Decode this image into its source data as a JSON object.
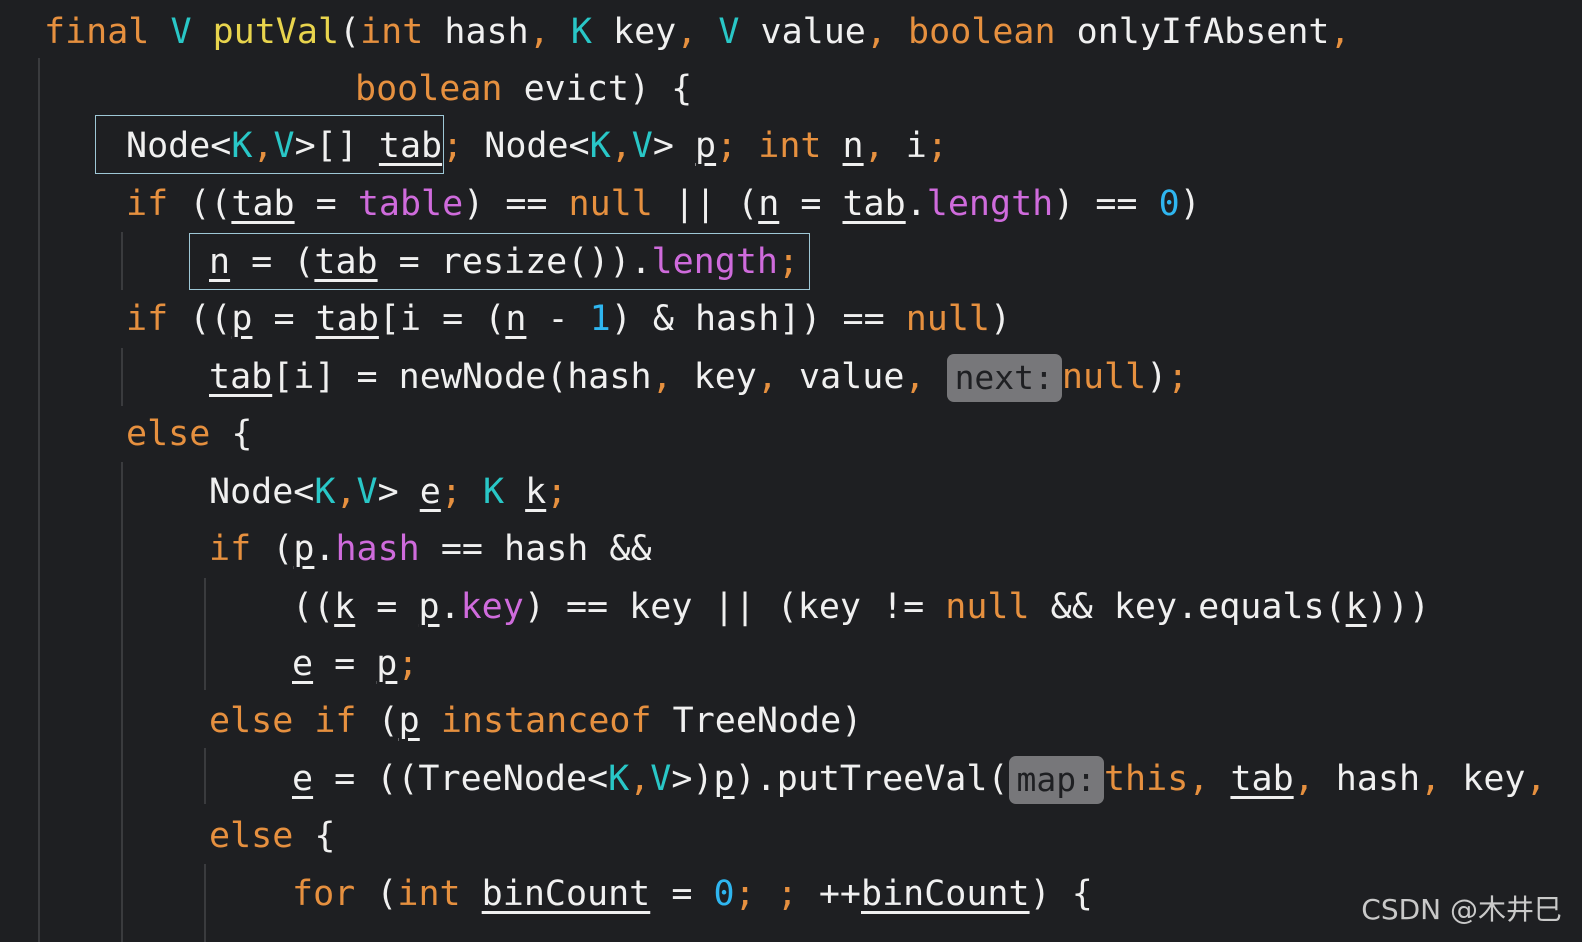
{
  "code": {
    "l1": {
      "final": "final",
      "V": "V",
      "putVal": "putVal",
      "paren": "(",
      "int": "int",
      "hash": " hash",
      "comma1": ",",
      "K": "K",
      "key": " key",
      "comma2": ",",
      "V2": "V",
      "value": " value",
      "comma3": ",",
      "boolean": "boolean",
      "onlyIfAbsent": " onlyIfAbsent",
      "comma4": ","
    },
    "l2": {
      "boolean": "boolean",
      "rest": " evict) {"
    },
    "l3": {
      "node1": "Node<",
      "K": "K",
      "comma": ",",
      "V": "V",
      "node1end": ">[] ",
      "tab": "tab",
      "semi1": ";",
      "node2": " Node<",
      "K2": "K",
      "comma2": ",",
      "V2": "V",
      "node2end": "> ",
      "p": "p",
      "semi2": ";",
      "int": "int",
      "n": "n",
      "comma3": ",",
      "i": " i",
      "semi3": ";"
    },
    "l4": {
      "if": "if",
      "open": " ((",
      "tab": "tab",
      "eq": " = ",
      "table": "table",
      "close": ") == ",
      "null": "null",
      "or": " || (",
      "n": "n",
      "eq2": " = ",
      "tab2": "tab",
      "dot": ".",
      "length": "length",
      "close2": ") == ",
      "zero": "0",
      "end": ")"
    },
    "l5": {
      "n": "n",
      "eq": " = (",
      "tab": "tab",
      "rest": " = resize()).",
      "length": "length",
      "semi": ";"
    },
    "l6": {
      "if": "if",
      "open": " ((",
      "p": "p",
      "eq": " = ",
      "tab": "tab",
      "mid": "[i = (",
      "n": "n",
      "minus": " - ",
      "one": "1",
      "rest": ") & hash]) == ",
      "null": "null",
      "end": ")"
    },
    "l7": {
      "tab": "tab",
      "mid": "[i] = newNode(hash",
      "c1": ",",
      "key": " key",
      "c2": ",",
      "value": " value",
      "c3": ",",
      "hint": "next:",
      "null": "null",
      "end": ")",
      "semi": ";"
    },
    "l8": {
      "else": "else",
      "rest": " {"
    },
    "l9": {
      "node": "Node<",
      "K": "K",
      "comma": ",",
      "V": "V",
      "end": "> ",
      "e": "e",
      "semi": ";",
      "K2": "K",
      "k": "k",
      "semi2": ";"
    },
    "l10": {
      "if": "if",
      "open": " (",
      "p": "p",
      "dot": ".",
      "hash": "hash",
      "rest": " == hash &&"
    },
    "l11": {
      "open": "((",
      "k": "k",
      "eq": " = ",
      "p": "p",
      "dot": ".",
      "key": "key",
      "mid": ") == key || (key != ",
      "null": "null",
      "rest": " && key.equals(",
      "k2": "k",
      "end": ")))"
    },
    "l12": {
      "e": "e",
      "eq": " = ",
      "p": "p",
      "semi": ";"
    },
    "l13": {
      "elseif": "else if",
      "open": " (",
      "p": "p",
      "instanceof": "instanceof",
      "rest": " TreeNode)"
    },
    "l14": {
      "e": "e",
      "mid": " = ((TreeNode<",
      "K": "K",
      "comma": ",",
      "V": "V",
      "mid2": ">)",
      "p": "p",
      "rest": ").putTreeVal(",
      "hint": "map:",
      "this": "this",
      "c1": ",",
      "tab": "tab",
      "c2": ",",
      "hash": " hash",
      "c3": ",",
      "key": " key",
      "c4": ","
    },
    "l15": {
      "else": "else",
      "rest": " {"
    },
    "l16": {
      "for": "for",
      "open": " (",
      "int": "int",
      "binCount": "binCount",
      "eq": " = ",
      "zero": "0",
      "semi1": ";",
      "semi2": ";",
      "plus": " ++",
      "binCount2": "binCount",
      "end": ") {"
    }
  },
  "watermark": "CSDN @木井巳",
  "colors": {
    "background": "#1e1f22",
    "keyword": "#e6903f",
    "type": "#29c7c7",
    "function": "#e8d44d",
    "field": "#cf6bdc",
    "number": "#2fb6f0",
    "text": "#f0f0f0",
    "hint_bg": "#77777a",
    "highlight_box": "#9ec7d6"
  }
}
